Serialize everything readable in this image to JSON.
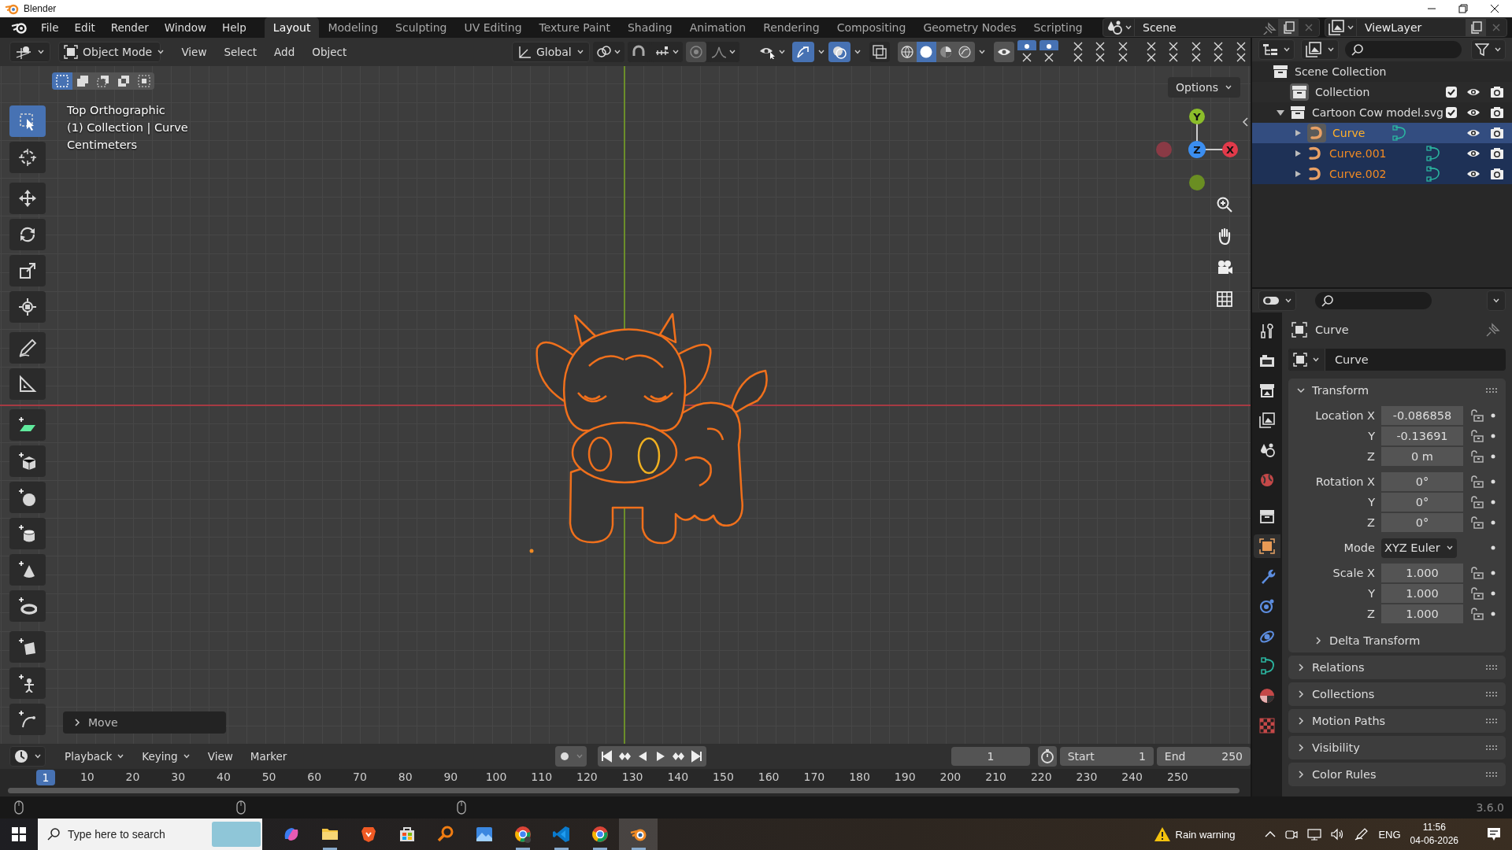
{
  "title_bar": {
    "title": "Blender"
  },
  "menu": [
    "File",
    "Edit",
    "Render",
    "Window",
    "Help"
  ],
  "workspaces": [
    {
      "label": "Layout",
      "selected": true
    },
    {
      "label": "Modeling",
      "selected": false
    },
    {
      "label": "Sculpting",
      "selected": false
    },
    {
      "label": "UV Editing",
      "selected": false
    },
    {
      "label": "Texture Paint",
      "selected": false
    },
    {
      "label": "Shading",
      "selected": false
    },
    {
      "label": "Animation",
      "selected": false
    },
    {
      "label": "Rendering",
      "selected": false
    },
    {
      "label": "Compositing",
      "selected": false
    },
    {
      "label": "Geometry Nodes",
      "selected": false
    },
    {
      "label": "Scripting",
      "selected": false
    }
  ],
  "scene": {
    "name": "Scene"
  },
  "view_layer": {
    "name": "ViewLayer"
  },
  "viewport": {
    "mode": "Object Mode",
    "menus": [
      "View",
      "Select",
      "Add",
      "Object"
    ],
    "orientation": "Global",
    "snap": false,
    "proportional_editing": false,
    "gizmos": true,
    "overlays": true,
    "xray": false,
    "select_modes": [
      {
        "kind": "set",
        "selected": true
      },
      {
        "kind": "extend",
        "selected": false
      },
      {
        "kind": "subtract",
        "selected": false
      },
      {
        "kind": "difference",
        "selected": false
      },
      {
        "kind": "intersect",
        "selected": false
      }
    ],
    "shading": [
      {
        "kind": "wireframe",
        "selected": false
      },
      {
        "kind": "solid",
        "selected": true
      },
      {
        "kind": "material",
        "selected": false
      },
      {
        "kind": "rendered",
        "selected": false
      }
    ],
    "layer_toggles": [
      {
        "on": true
      },
      {
        "on": true
      },
      {
        "on": false
      },
      {
        "on": false
      },
      {
        "on": false
      },
      {
        "on": false
      },
      {
        "on": false
      },
      {
        "on": false
      },
      {
        "on": false
      },
      {
        "on": false
      }
    ],
    "options": "Options",
    "overlay_text": [
      "Top Orthographic",
      "(1) Collection | Curve",
      "Centimeters"
    ],
    "tools": [
      {
        "kind": "select",
        "selected": true
      },
      {
        "kind": "cursor",
        "selected": false
      },
      {
        "kind": "move",
        "selected": false
      },
      {
        "kind": "rotate",
        "selected": false
      },
      {
        "kind": "scale",
        "selected": false
      },
      {
        "kind": "transform",
        "selected": false
      },
      {
        "kind": "annotate",
        "selected": false
      },
      {
        "kind": "measure",
        "selected": false
      },
      {
        "kind": "add_plane",
        "selected": false
      },
      {
        "kind": "add_cube",
        "selected": false
      },
      {
        "kind": "add_sphere",
        "selected": false
      },
      {
        "kind": "add_cylinder",
        "selected": false
      },
      {
        "kind": "add_cone",
        "selected": false
      },
      {
        "kind": "add_torus",
        "selected": false
      },
      {
        "kind": "add_prism",
        "selected": false
      },
      {
        "kind": "add_figure",
        "selected": false
      },
      {
        "kind": "add_curve",
        "selected": false
      }
    ],
    "gizmo": {
      "y": "Y",
      "z": "Z",
      "x": "X"
    },
    "last_operator": "Move"
  },
  "outliner": {
    "items": [
      {
        "label": "Scene Collection",
        "kind": "scene",
        "children": [
          {
            "label": "Collection",
            "kind": "collection",
            "checked": true,
            "active": true,
            "selected": false
          },
          {
            "label": "Cartoon Cow model.svg",
            "kind": "collection",
            "checked": true,
            "active": false,
            "selected": false,
            "expanded": true,
            "children": [
              {
                "label": "Curve",
                "kind": "curve",
                "selected": true,
                "active": true,
                "expanded": false
              },
              {
                "label": "Curve.001",
                "kind": "curve",
                "selected": true,
                "active": false,
                "expanded": false
              },
              {
                "label": "Curve.002",
                "kind": "curve",
                "selected": true,
                "active": false,
                "expanded": false
              }
            ]
          }
        ]
      }
    ]
  },
  "properties": {
    "object": "Curve",
    "data": "Curve",
    "tabs": [
      {
        "kind": "tool",
        "selected": false
      },
      {
        "kind": "render",
        "selected": false
      },
      {
        "kind": "output",
        "selected": false
      },
      {
        "kind": "view_layer",
        "selected": false
      },
      {
        "kind": "scene",
        "selected": false
      },
      {
        "kind": "world",
        "selected": false
      },
      {
        "kind": "collection",
        "selected": false
      },
      {
        "kind": "object",
        "selected": true
      },
      {
        "kind": "modifiers",
        "selected": false
      },
      {
        "kind": "particles",
        "selected": false
      },
      {
        "kind": "physics",
        "selected": false
      },
      {
        "kind": "data",
        "selected": false
      },
      {
        "kind": "material",
        "selected": false
      },
      {
        "kind": "texture",
        "selected": false
      }
    ],
    "transform": {
      "title": "Transform",
      "expanded": true,
      "groups": [
        {
          "rows": [
            {
              "label": "Location X",
              "value": "-0.086858",
              "kind": "number"
            },
            {
              "label": "Y",
              "value": "-0.13691",
              "kind": "number"
            },
            {
              "label": "Z",
              "value": "0 m",
              "kind": "number"
            }
          ]
        },
        {
          "rows": [
            {
              "label": "Rotation X",
              "value": "0°",
              "kind": "number"
            },
            {
              "label": "Y",
              "value": "0°",
              "kind": "number"
            },
            {
              "label": "Z",
              "value": "0°",
              "kind": "number"
            }
          ]
        },
        {
          "rows": [
            {
              "label": "Mode",
              "value": "XYZ Euler",
              "kind": "dropdown"
            }
          ]
        },
        {
          "rows": [
            {
              "label": "Scale X",
              "value": "1.000",
              "kind": "number"
            },
            {
              "label": "Y",
              "value": "1.000",
              "kind": "number"
            },
            {
              "label": "Z",
              "value": "1.000",
              "kind": "number"
            }
          ]
        }
      ],
      "sub_panels": [
        {
          "title": "Delta Transform",
          "expanded": false
        }
      ]
    },
    "panels": [
      {
        "title": "Relations",
        "expanded": false
      },
      {
        "title": "Collections",
        "expanded": false
      },
      {
        "title": "Motion Paths",
        "expanded": false
      },
      {
        "title": "Visibility",
        "expanded": false
      },
      {
        "title": "Color Rules",
        "expanded": false
      }
    ]
  },
  "timeline": {
    "menus": [
      {
        "label": "Playback",
        "dropdown": true
      },
      {
        "label": "Keying",
        "dropdown": true
      },
      {
        "label": "View",
        "dropdown": false
      },
      {
        "label": "Marker",
        "dropdown": false
      }
    ],
    "current_frame": "1",
    "start_label": "Start",
    "start": "1",
    "end_label": "End",
    "end": "250",
    "ruler_current": "1",
    "ruler": [
      "10",
      "20",
      "30",
      "40",
      "50",
      "60",
      "70",
      "80",
      "90",
      "100",
      "110",
      "120",
      "130",
      "140",
      "150",
      "160",
      "170",
      "180",
      "190",
      "200",
      "210",
      "220",
      "230",
      "240",
      "250"
    ]
  },
  "status_bar": {
    "version": "3.6.0"
  },
  "taskbar": {
    "search_placeholder": "Type here to search",
    "apps": [
      {
        "kind": "copilot",
        "running": false,
        "active": false
      },
      {
        "kind": "folder",
        "running": true,
        "active": false
      },
      {
        "kind": "lion-browser",
        "running": false,
        "active": false
      },
      {
        "kind": "store",
        "running": false,
        "active": false
      },
      {
        "kind": "magnifier",
        "running": false,
        "active": false
      },
      {
        "kind": "photos",
        "running": false,
        "active": false
      },
      {
        "kind": "chrome-profile",
        "running": true,
        "active": false
      },
      {
        "kind": "code",
        "running": true,
        "active": false
      },
      {
        "kind": "chrome",
        "running": true,
        "active": false
      },
      {
        "kind": "blender",
        "running": true,
        "active": true
      }
    ],
    "weather": "Rain warning",
    "language": "ENG",
    "time": "11:56",
    "date": "04-06-2026"
  }
}
